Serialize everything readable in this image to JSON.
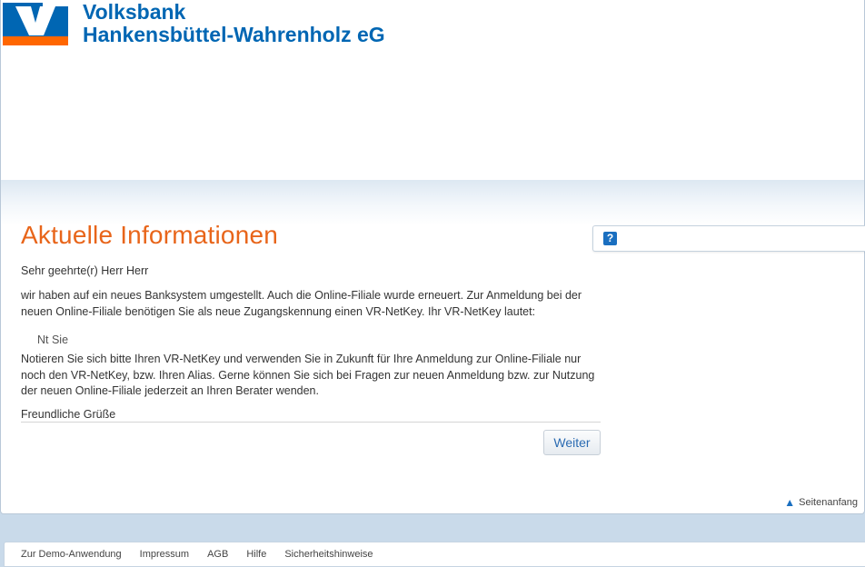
{
  "header": {
    "bank_name_line1": "Volksbank",
    "bank_name_line2": "Hankensbüttel-Wahrenholz eG",
    "logo_icon": "volksbank-logo"
  },
  "main": {
    "title": "Aktuelle Informationen",
    "salutation": "Sehr geehrte(r) Herr Herr",
    "paragraph1": "wir haben auf ein neues Banksystem umgestellt. Auch die Online-Filiale wurde erneuert. Zur Anmeldung bei der neuen Online-Filiale benötigen Sie als neue Zugangskennung einen VR-NetKey. Ihr VR-NetKey lautet:",
    "netkey_value": "Nt Sie",
    "paragraph2": "Notieren Sie sich bitte Ihren VR-NetKey und verwenden Sie in Zukunft für Ihre Anmeldung zur Online-Filiale nur noch den VR-NetKey, bzw. Ihren Alias. Gerne können Sie sich bei Fragen zur neuen Anmeldung bzw. zur Nutzung der neuen Online-Filiale jederzeit an Ihren Berater wenden.",
    "closing": "Freundliche Grüße",
    "continue_label": "Weiter"
  },
  "help": {
    "icon_label": "?"
  },
  "page_top_link": "Seitenanfang",
  "footer": {
    "links": [
      "Zur Demo-Anwendung",
      "Impressum",
      "AGB",
      "Hilfe",
      "Sicherheitshinweise"
    ]
  },
  "colors": {
    "brand_blue": "#0066b3",
    "brand_orange": "#ff6600",
    "title_orange": "#e8651a",
    "page_background": "#c9daea"
  }
}
